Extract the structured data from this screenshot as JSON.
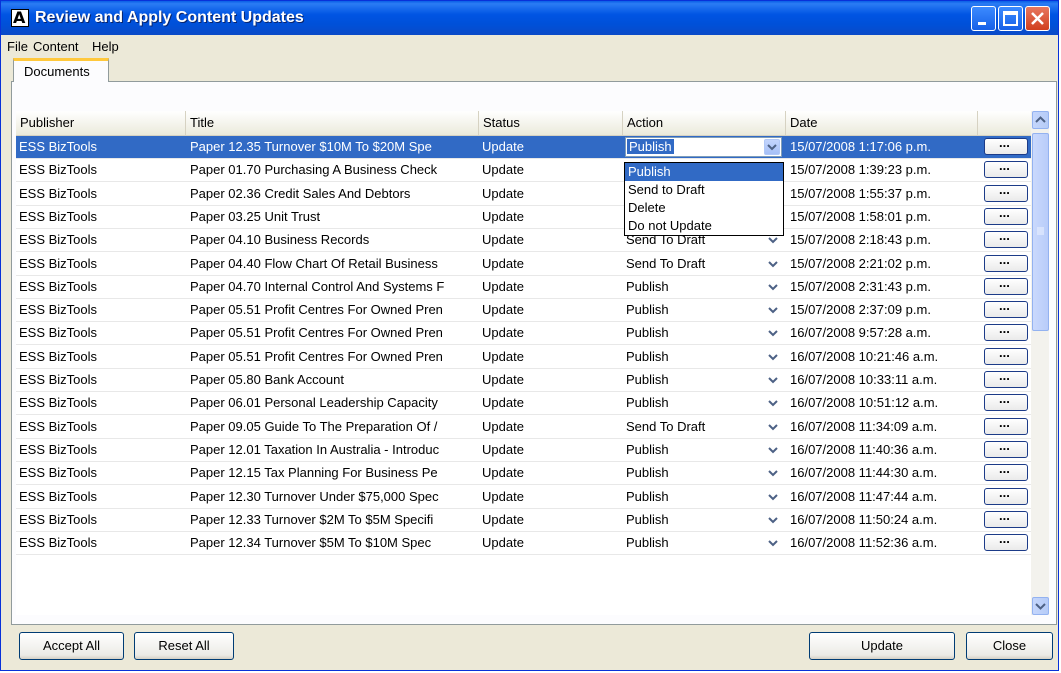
{
  "window": {
    "title": "Review and Apply Content Updates"
  },
  "menu": {
    "file": "File",
    "content": "Content",
    "help": "Help"
  },
  "tab": {
    "documents": "Documents"
  },
  "columns": {
    "publisher": "Publisher",
    "title": "Title",
    "status": "Status",
    "action": "Action",
    "date": "Date"
  },
  "rows": [
    {
      "publisher": "ESS BizTools",
      "title": "Paper 12.35 Turnover $10M To $20M Spe",
      "status": "Update",
      "action": "Publish",
      "date": "15/07/2008 1:17:06 p.m."
    },
    {
      "publisher": "ESS BizTools",
      "title": "Paper 01.70 Purchasing A Business Check",
      "status": "Update",
      "action": "",
      "date": "15/07/2008 1:39:23 p.m."
    },
    {
      "publisher": "ESS BizTools",
      "title": "Paper 02.36 Credit Sales And Debtors",
      "status": "Update",
      "action": "",
      "date": "15/07/2008 1:55:37 p.m."
    },
    {
      "publisher": "ESS BizTools",
      "title": "Paper 03.25 Unit Trust",
      "status": "Update",
      "action": "",
      "date": "15/07/2008 1:58:01 p.m."
    },
    {
      "publisher": "ESS BizTools",
      "title": "Paper 04.10 Business Records",
      "status": "Update",
      "action": "Send To Draft",
      "date": "15/07/2008 2:18:43 p.m."
    },
    {
      "publisher": "ESS BizTools",
      "title": "Paper 04.40 Flow Chart Of Retail Business",
      "status": "Update",
      "action": "Send To Draft",
      "date": "15/07/2008 2:21:02 p.m."
    },
    {
      "publisher": "ESS BizTools",
      "title": "Paper 04.70 Internal Control And Systems F",
      "status": "Update",
      "action": "Publish",
      "date": "15/07/2008 2:31:43 p.m."
    },
    {
      "publisher": "ESS BizTools",
      "title": "Paper 05.51 Profit Centres For Owned Pren",
      "status": "Update",
      "action": "Publish",
      "date": "15/07/2008 2:37:09 p.m."
    },
    {
      "publisher": "ESS BizTools",
      "title": "Paper 05.51 Profit Centres For Owned Pren",
      "status": "Update",
      "action": "Publish",
      "date": "16/07/2008 9:57:28 a.m."
    },
    {
      "publisher": "ESS BizTools",
      "title": "Paper 05.51 Profit Centres For Owned Pren",
      "status": "Update",
      "action": "Publish",
      "date": "16/07/2008 10:21:46 a.m."
    },
    {
      "publisher": "ESS BizTools",
      "title": "Paper 05.80 Bank Account",
      "status": "Update",
      "action": "Publish",
      "date": "16/07/2008 10:33:11 a.m."
    },
    {
      "publisher": "ESS BizTools",
      "title": "Paper 06.01 Personal Leadership Capacity",
      "status": "Update",
      "action": "Publish",
      "date": "16/07/2008 10:51:12 a.m."
    },
    {
      "publisher": "ESS BizTools",
      "title": "Paper 09.05 Guide To The Preparation Of /",
      "status": "Update",
      "action": "Send To Draft",
      "date": "16/07/2008 11:34:09 a.m."
    },
    {
      "publisher": "ESS BizTools",
      "title": "Paper 12.01 Taxation In Australia - Introduc",
      "status": "Update",
      "action": "Publish",
      "date": "16/07/2008 11:40:36 a.m."
    },
    {
      "publisher": "ESS BizTools",
      "title": "Paper 12.15 Tax Planning For Business Pe",
      "status": "Update",
      "action": "Publish",
      "date": "16/07/2008 11:44:30 a.m."
    },
    {
      "publisher": "ESS BizTools",
      "title": "Paper 12.30 Turnover Under $75,000 Spec",
      "status": "Update",
      "action": "Publish",
      "date": "16/07/2008 11:47:44 a.m."
    },
    {
      "publisher": "ESS BizTools",
      "title": "Paper 12.33 Turnover $2M To $5M Specifi",
      "status": "Update",
      "action": "Publish",
      "date": "16/07/2008 11:50:24 a.m."
    },
    {
      "publisher": "ESS BizTools",
      "title": "Paper 12.34 Turnover $5M To $10M Spec",
      "status": "Update",
      "action": "Publish",
      "date": "16/07/2008 11:52:36 a.m."
    }
  ],
  "dropdown": {
    "selected": "Publish",
    "options": [
      "Publish",
      "Send to Draft",
      "Delete",
      "Do not Update"
    ]
  },
  "ellipsis": "...",
  "buttons": {
    "accept_all": "Accept All",
    "reset_all": "Reset All",
    "update": "Update",
    "close": "Close"
  },
  "colors": {
    "titlebar": "#0054e3",
    "selection": "#316ac5",
    "window_bg": "#ece9d8"
  }
}
